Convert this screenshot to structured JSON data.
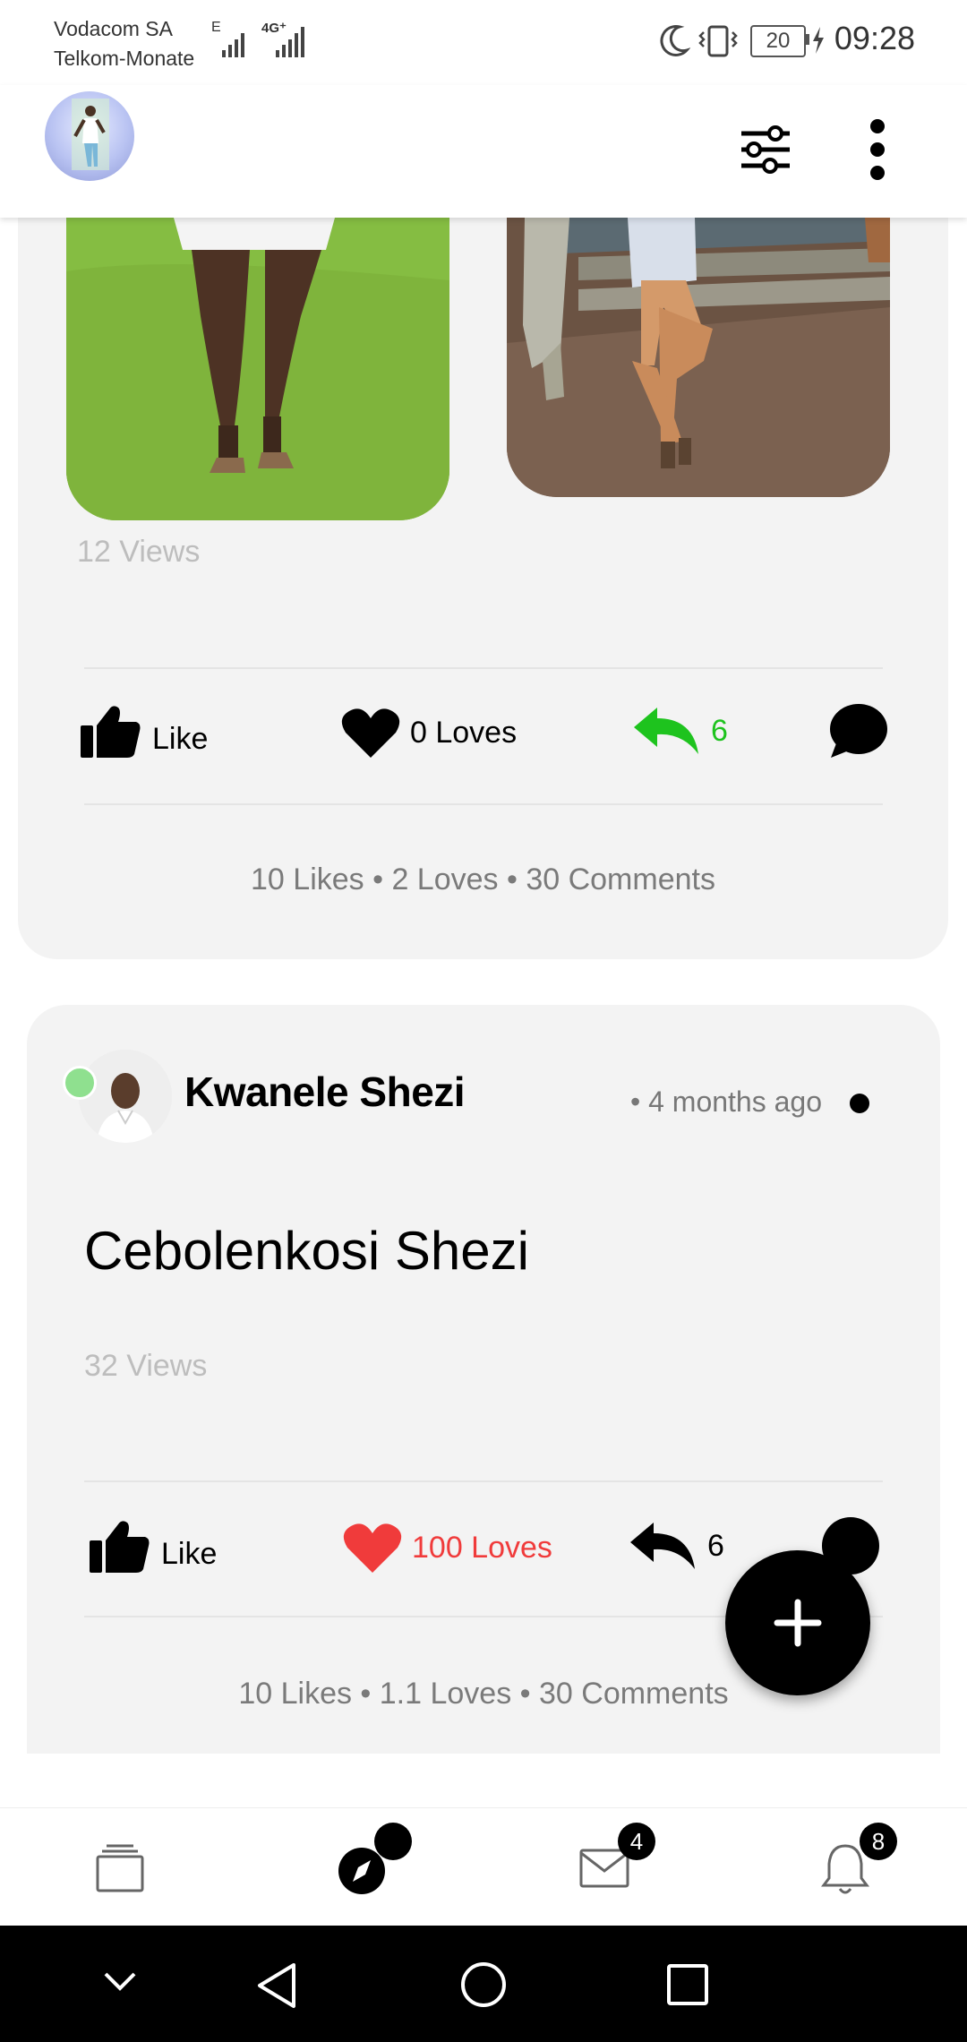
{
  "status_bar": {
    "carrier_1": "Vodacom SA",
    "carrier_2": "Telkom-Monate",
    "net_1": "E",
    "net_2": "4G⁺",
    "battery": "20",
    "time": "09:28"
  },
  "posts": [
    {
      "views": "12 Views",
      "like_label": "Like",
      "loves_label": "0 Loves",
      "share_count": "6",
      "summary": "10 Likes • 2 Loves • 30 Comments"
    },
    {
      "author": "Kwanele Shezi",
      "time_ago": "• 4 months ago",
      "title": "Cebolenkosi Shezi",
      "views": "32 Views",
      "like_label": "Like",
      "loves_label": "100 Loves",
      "share_count": "6",
      "summary": "10 Likes • 1.1 Loves • 30 Comments"
    }
  ],
  "bottom_nav": {
    "messages_badge": "4",
    "notifications_badge": "8"
  },
  "colors": {
    "online": "#8fe08f",
    "share_active": "#1ec31e",
    "love_active": "#f03b3b",
    "card_bg": "#f3f3f3"
  }
}
